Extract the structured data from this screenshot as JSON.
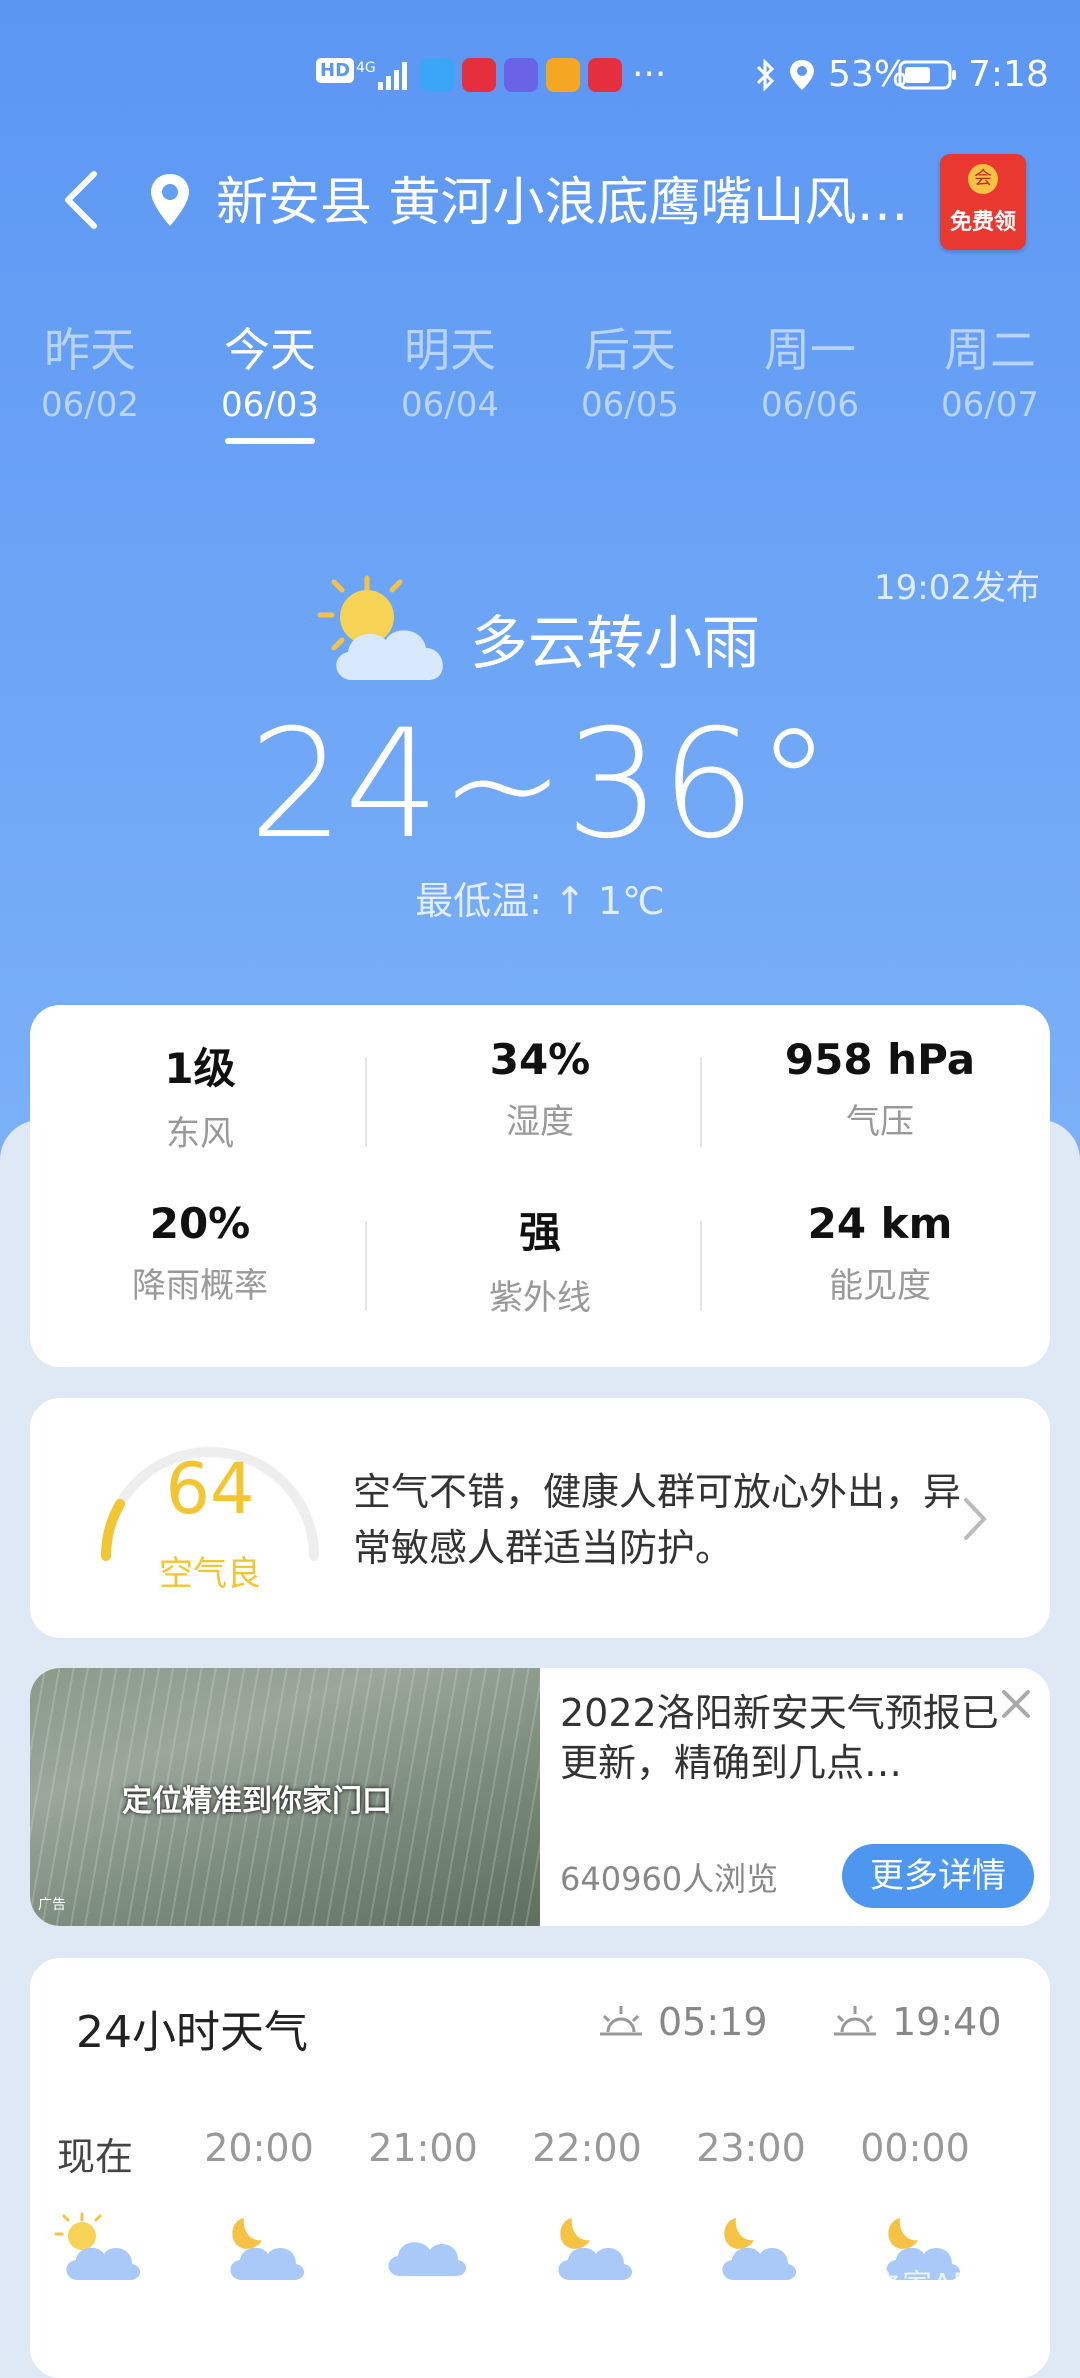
{
  "status_bar": {
    "battery": "53%",
    "time": "7:18",
    "network": "4G",
    "hd": "HD",
    "more": "···"
  },
  "header": {
    "location": "新安县 黄河小浪底鹰嘴山风…",
    "promo_label": "免费领",
    "promo_coin": "会"
  },
  "days": [
    {
      "name": "昨天",
      "date": "06/02"
    },
    {
      "name": "今天",
      "date": "06/03"
    },
    {
      "name": "明天",
      "date": "06/04"
    },
    {
      "name": "后天",
      "date": "06/05"
    },
    {
      "name": "周一",
      "date": "06/06"
    },
    {
      "name": "周二",
      "date": "06/07"
    }
  ],
  "today": {
    "published": "19:02发布",
    "condition": "多云转小雨",
    "temperature": "24~36°",
    "min_temp_note": "最低温: ↑ 1℃",
    "icon": "partly-cloudy-day-icon"
  },
  "stats": [
    {
      "value": "1级",
      "label": "东风"
    },
    {
      "value": "34%",
      "label": "湿度"
    },
    {
      "value": "958 hPa",
      "label": "气压"
    },
    {
      "value": "20%",
      "label": "降雨概率"
    },
    {
      "value": "强",
      "label": "紫外线"
    },
    {
      "value": "24 km",
      "label": "能见度"
    }
  ],
  "aqi": {
    "value": "64",
    "level": "空气良",
    "description": "空气不错，健康人群可放心外出，异常敏感人群适当防护。",
    "color": "#f2c531"
  },
  "ad": {
    "image_text": "定位精准到你家门口",
    "title": "2022洛阳新安天气预报已更新，精确到几点…",
    "views": "640960人浏览",
    "button": "更多详情",
    "badge": "广告"
  },
  "hourly": {
    "title": "24小时天气",
    "sunrise": "05:19",
    "sunset": "19:40",
    "hours": [
      {
        "time": "现在",
        "icon": "partly-cloudy-day-icon"
      },
      {
        "time": "20:00",
        "icon": "partly-cloudy-night-icon"
      },
      {
        "time": "21:00",
        "icon": "cloudy-icon"
      },
      {
        "time": "22:00",
        "icon": "partly-cloudy-night-icon"
      },
      {
        "time": "23:00",
        "icon": "partly-cloudy-night-icon"
      },
      {
        "time": "00:00",
        "icon": "partly-cloudy-night-icon"
      }
    ]
  },
  "watermark": "野钓之家APP"
}
